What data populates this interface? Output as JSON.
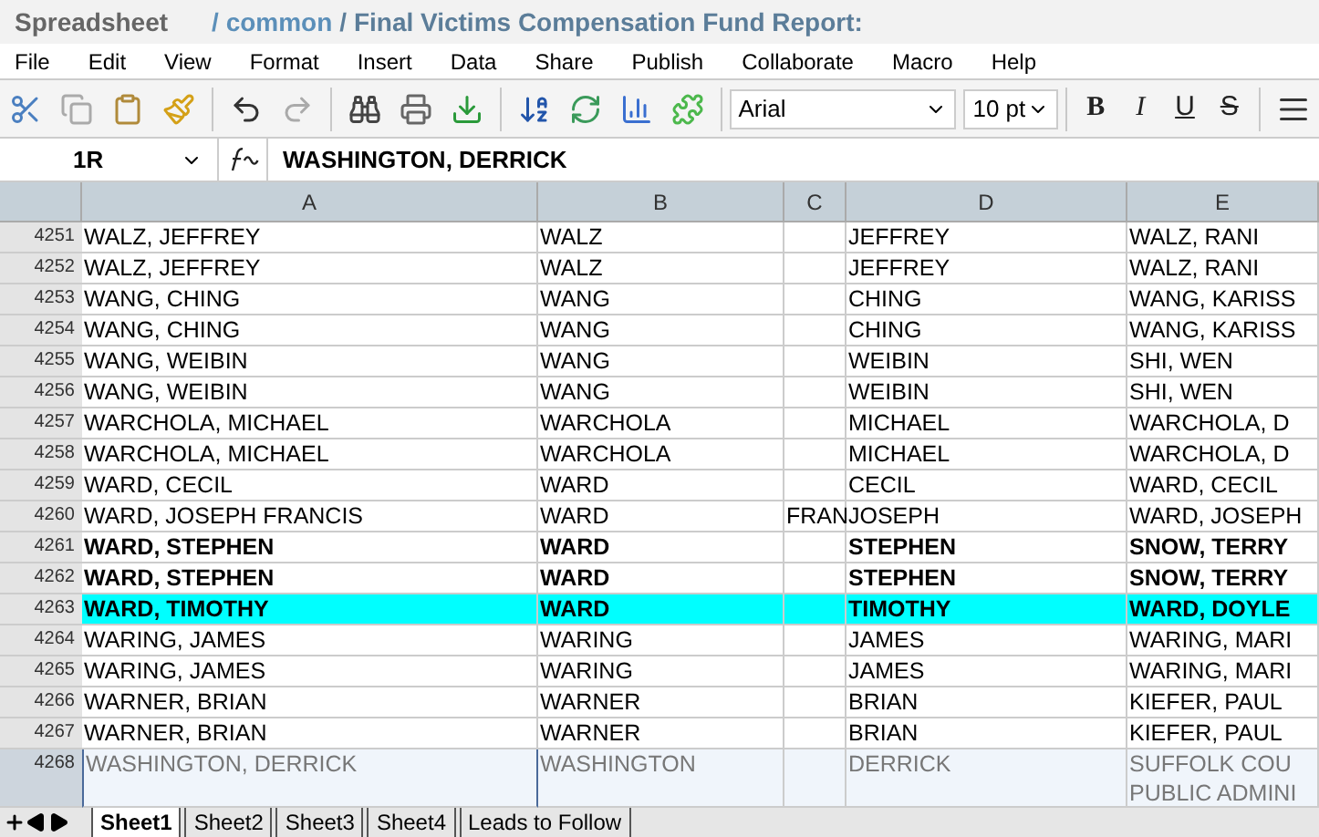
{
  "app_title": "Spreadsheet",
  "breadcrumb": {
    "folder": "/ common",
    "document": "/ Final Victims Compensation Fund Report:"
  },
  "menu": [
    "File",
    "Edit",
    "View",
    "Format",
    "Insert",
    "Data",
    "Share",
    "Publish",
    "Collaborate",
    "Macro",
    "Help"
  ],
  "toolbar": {
    "font": "Arial",
    "size": "10 pt",
    "format_buttons": [
      {
        "label": "B",
        "kind": "bold"
      },
      {
        "label": "I",
        "kind": "italic"
      },
      {
        "label": "U",
        "kind": "underline"
      },
      {
        "label": "S",
        "kind": "strike"
      }
    ]
  },
  "formula_bar": {
    "cell_ref": "1R",
    "value": "WASHINGTON, DERRICK"
  },
  "columns": [
    "A",
    "B",
    "C",
    "D",
    "E"
  ],
  "rows": [
    {
      "number": "4251",
      "cells": [
        "WALZ, JEFFREY",
        "WALZ",
        "",
        "JEFFREY",
        "WALZ, RANI"
      ],
      "bold": false,
      "highlighted": false,
      "selected": false
    },
    {
      "number": "4252",
      "cells": [
        "WALZ, JEFFREY",
        "WALZ",
        "",
        "JEFFREY",
        "WALZ, RANI"
      ],
      "bold": false,
      "highlighted": false,
      "selected": false
    },
    {
      "number": "4253",
      "cells": [
        "WANG, CHING",
        "WANG",
        "",
        "CHING",
        "WANG, KARISS"
      ],
      "bold": false,
      "highlighted": false,
      "selected": false
    },
    {
      "number": "4254",
      "cells": [
        "WANG, CHING",
        "WANG",
        "",
        "CHING",
        "WANG, KARISS"
      ],
      "bold": false,
      "highlighted": false,
      "selected": false
    },
    {
      "number": "4255",
      "cells": [
        "WANG, WEIBIN",
        "WANG",
        "",
        "WEIBIN",
        "SHI, WEN"
      ],
      "bold": false,
      "highlighted": false,
      "selected": false
    },
    {
      "number": "4256",
      "cells": [
        "WANG, WEIBIN",
        "WANG",
        "",
        "WEIBIN",
        "SHI, WEN"
      ],
      "bold": false,
      "highlighted": false,
      "selected": false
    },
    {
      "number": "4257",
      "cells": [
        "WARCHOLA, MICHAEL",
        "WARCHOLA",
        "",
        "MICHAEL",
        "WARCHOLA, D"
      ],
      "bold": false,
      "highlighted": false,
      "selected": false
    },
    {
      "number": "4258",
      "cells": [
        "WARCHOLA, MICHAEL",
        "WARCHOLA",
        "",
        "MICHAEL",
        "WARCHOLA, D"
      ],
      "bold": false,
      "highlighted": false,
      "selected": false
    },
    {
      "number": "4259",
      "cells": [
        "WARD, CECIL",
        "WARD",
        "",
        "CECIL",
        "WARD, CECIL"
      ],
      "bold": false,
      "highlighted": false,
      "selected": false
    },
    {
      "number": "4260",
      "cells": [
        "WARD, JOSEPH FRANCIS",
        "WARD",
        "FRAN",
        "JOSEPH",
        "WARD, JOSEPH"
      ],
      "bold": false,
      "highlighted": false,
      "selected": false
    },
    {
      "number": "4261",
      "cells": [
        "WARD, STEPHEN",
        "WARD",
        "",
        "STEPHEN",
        "SNOW, TERRY"
      ],
      "bold": true,
      "highlighted": false,
      "selected": false
    },
    {
      "number": "4262",
      "cells": [
        "WARD, STEPHEN",
        "WARD",
        "",
        "STEPHEN",
        "SNOW, TERRY"
      ],
      "bold": true,
      "highlighted": false,
      "selected": false
    },
    {
      "number": "4263",
      "cells": [
        "WARD, TIMOTHY",
        "WARD",
        "",
        "TIMOTHY",
        "WARD, DOYLE"
      ],
      "bold": true,
      "highlighted": true,
      "selected": false
    },
    {
      "number": "4264",
      "cells": [
        "WARING, JAMES",
        "WARING",
        "",
        "JAMES",
        "WARING, MARI"
      ],
      "bold": false,
      "highlighted": false,
      "selected": false
    },
    {
      "number": "4265",
      "cells": [
        "WARING, JAMES",
        "WARING",
        "",
        "JAMES",
        "WARING, MARI"
      ],
      "bold": false,
      "highlighted": false,
      "selected": false
    },
    {
      "number": "4266",
      "cells": [
        "WARNER, BRIAN",
        "WARNER",
        "",
        "BRIAN",
        "KIEFER, PAUL"
      ],
      "bold": false,
      "highlighted": false,
      "selected": false
    },
    {
      "number": "4267",
      "cells": [
        "WARNER, BRIAN",
        "WARNER",
        "",
        "BRIAN",
        "KIEFER, PAUL"
      ],
      "bold": false,
      "highlighted": false,
      "selected": false
    },
    {
      "number": "4268",
      "cells": [
        "WASHINGTON, DERRICK",
        "WASHINGTON",
        "",
        "DERRICK",
        "SUFFOLK COU\nPUBLIC ADMINI"
      ],
      "bold": false,
      "highlighted": false,
      "selected": true
    }
  ],
  "sheet_tabs": [
    {
      "label": "Sheet1",
      "selected": true
    },
    {
      "label": "Sheet2",
      "selected": false
    },
    {
      "label": "Sheet3",
      "selected": false
    },
    {
      "label": "Sheet4",
      "selected": false
    },
    {
      "label": "Leads to Follow",
      "selected": false
    }
  ]
}
